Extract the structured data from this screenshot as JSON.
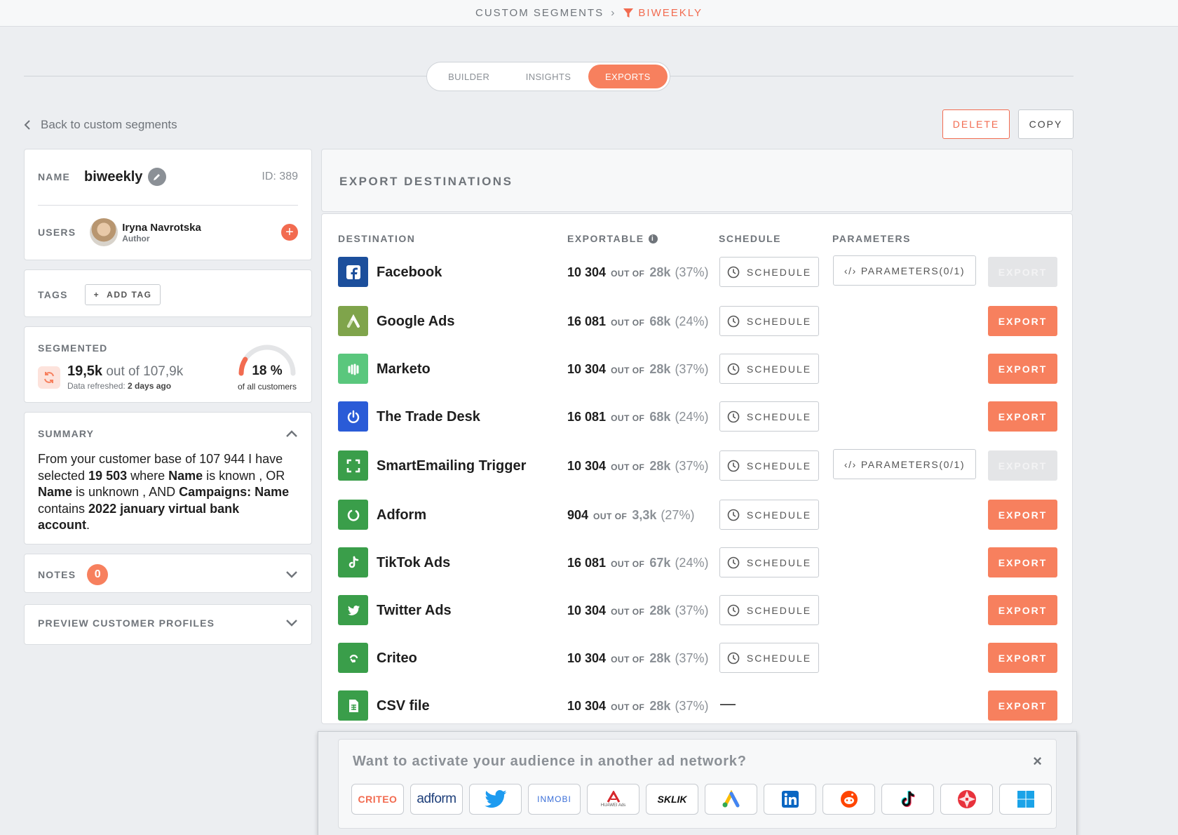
{
  "breadcrumb": {
    "parent": "CUSTOM SEGMENTS",
    "current": "BIWEEKLY"
  },
  "tabs": [
    {
      "label": "BUILDER",
      "active": false
    },
    {
      "label": "INSIGHTS",
      "active": false
    },
    {
      "label": "EXPORTS",
      "active": true
    }
  ],
  "back_label": "Back to custom segments",
  "actions": {
    "delete": "DELETE",
    "copy": "COPY"
  },
  "segment": {
    "name_label": "NAME",
    "name": "biweekly",
    "id": "ID: 389",
    "users_label": "USERS",
    "user_name": "Iryna Navrotska",
    "user_role": "Author"
  },
  "tags": {
    "label": "TAGS",
    "add_label": "ADD TAG"
  },
  "segmented": {
    "label": "SEGMENTED",
    "count": "19,5k",
    "out_of": "out of 107,9k",
    "refreshed_prefix": "Data refreshed: ",
    "refreshed_value": "2 days ago",
    "percent": "18 %",
    "percent_value": 18,
    "percent_sub": "of all customers"
  },
  "summary": {
    "label": "SUMMARY",
    "t1": "From your customer base of 107 944 I have selected ",
    "b1": "19 503",
    "t2": " where ",
    "b2": "Name",
    "t3": " is known , OR ",
    "b3": "Name",
    "t4": " is unknown , AND ",
    "b4": "Campaigns: Name",
    "t5": " contains ",
    "b5": "2022 january virtual bank account",
    "t6": "."
  },
  "notes": {
    "label": "NOTES",
    "count": "0"
  },
  "preview": {
    "label": "PREVIEW CUSTOMER PROFILES"
  },
  "exports": {
    "title": "EXPORT DESTINATIONS",
    "headers": {
      "destination": "DESTINATION",
      "exportable": "EXPORTABLE",
      "schedule": "SCHEDULE",
      "parameters": "PARAMETERS"
    },
    "out_of": "OUT OF",
    "schedule_label": "SCHEDULE",
    "parameters_label": "PARAMETERS(0/1)",
    "export_label": "EXPORT",
    "dash": "—",
    "rows": [
      {
        "name": "Facebook",
        "count": "10 304",
        "total": "28k",
        "pct": "(37%)",
        "color": "#1c4f9c",
        "icon": "facebook-icon"
      },
      {
        "name": "Google Ads",
        "count": "16 081",
        "total": "68k",
        "pct": "(24%)",
        "color": "#7fa44b",
        "icon": "google-ads-icon"
      },
      {
        "name": "Marketo",
        "count": "10 304",
        "total": "28k",
        "pct": "(37%)",
        "color": "#5ac77d",
        "icon": "marketo-icon"
      },
      {
        "name": "The Trade Desk",
        "count": "16 081",
        "total": "68k",
        "pct": "(24%)",
        "color": "#2a5bd7",
        "icon": "trade-desk-icon"
      },
      {
        "name": "SmartEmailing Trigger",
        "count": "10 304",
        "total": "28k",
        "pct": "(37%)",
        "color": "#3a9e4a",
        "icon": "smartemailing-icon"
      },
      {
        "name": "Adform",
        "count": "904",
        "total": "3,3k",
        "pct": "(27%)",
        "color": "#3a9e4a",
        "icon": "adform-icon"
      },
      {
        "name": "TikTok Ads",
        "count": "16 081",
        "total": "67k",
        "pct": "(24%)",
        "color": "#3a9e4a",
        "icon": "tiktok-icon"
      },
      {
        "name": "Twitter Ads",
        "count": "10 304",
        "total": "28k",
        "pct": "(37%)",
        "color": "#3a9e4a",
        "icon": "twitter-icon"
      },
      {
        "name": "Criteo",
        "count": "10 304",
        "total": "28k",
        "pct": "(37%)",
        "color": "#3a9e4a",
        "icon": "criteo-icon"
      },
      {
        "name": "CSV file",
        "count": "10 304",
        "total": "28k",
        "pct": "(37%)",
        "color": "#3a9e4a",
        "icon": "csv-file-icon"
      }
    ]
  },
  "promo": {
    "title": "Want to activate your audience in another ad network?",
    "close": "×",
    "logos": {
      "criteo": "CRITEO",
      "adform": "adform",
      "inmobi": "INMOBI",
      "huawei": "HUAWEI Ads",
      "sklik": "SKLIK"
    }
  },
  "colors": {
    "accent": "#f7805e",
    "danger": "#f26b50",
    "muted": "#6f747a"
  }
}
